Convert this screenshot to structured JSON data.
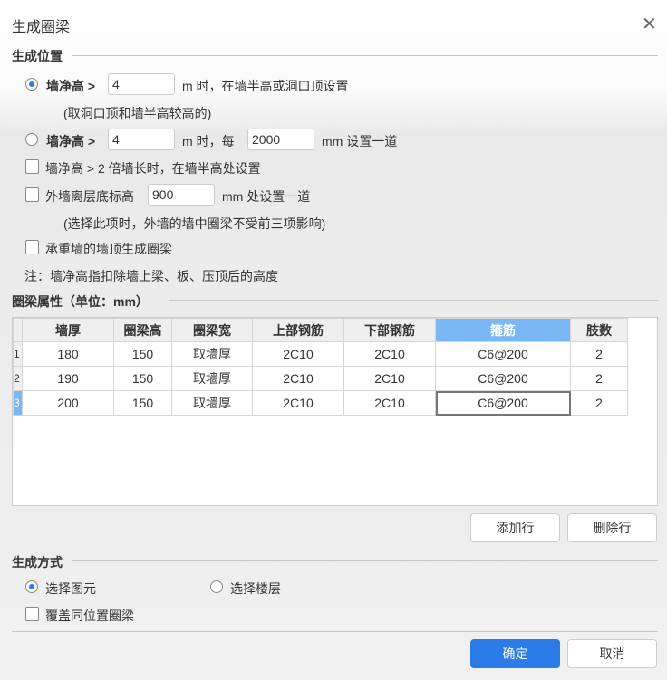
{
  "title": "生成圈梁",
  "section_position": "生成位置",
  "opt1": {
    "label": "墙净高 >",
    "value": "4",
    "suffix": "m 时，在墙半高或洞口顶设置",
    "note": "(取洞口顶和墙半高较高的)",
    "checked": true
  },
  "opt2": {
    "label": "墙净高 >",
    "value": "4",
    "mid": "m 时，每",
    "value2": "2000",
    "suffix": "mm 设置一道",
    "checked": false
  },
  "opt3": {
    "label": "墙净高 > 2 倍墙长时，在墙半高处设置",
    "checked": false
  },
  "opt4": {
    "label": "外墙离层底标高",
    "value": "900",
    "suffix": "mm 处设置一道",
    "note": "(选择此项时，外墙的墙中圈梁不受前三项影响)",
    "checked": false
  },
  "opt5": {
    "label": "承重墙的墙顶生成圈梁",
    "checked": false
  },
  "footnote": "注：墙净高指扣除墙上梁、板、压顶后的高度",
  "section_props": "圈梁属性（单位：mm）",
  "table": {
    "headers": [
      "墙厚",
      "圈梁高",
      "圈梁宽",
      "上部钢筋",
      "下部钢筋",
      "箍筋",
      "肢数"
    ],
    "rows": [
      {
        "n": "1",
        "cells": [
          "180",
          "150",
          "取墙厚",
          "2C10",
          "2C10",
          "C6@200",
          "2"
        ]
      },
      {
        "n": "2",
        "cells": [
          "190",
          "150",
          "取墙厚",
          "2C10",
          "2C10",
          "C6@200",
          "2"
        ]
      },
      {
        "n": "3",
        "cells": [
          "200",
          "150",
          "取墙厚",
          "2C10",
          "2C10",
          "C6@200",
          "2"
        ]
      }
    ]
  },
  "add_row": "添加行",
  "del_row": "删除行",
  "section_method": "生成方式",
  "method1": "选择图元",
  "method2": "选择楼层",
  "overwrite": "覆盖同位置圈梁",
  "ok": "确定",
  "cancel": "取消",
  "accent": "#2b7ce9"
}
